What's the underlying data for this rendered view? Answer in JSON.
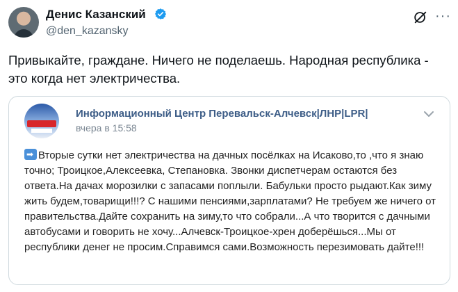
{
  "tweet": {
    "author_name": "Денис Казанский",
    "handle": "@den_kazansky",
    "text": "Привыкайте, граждане. Ничего не поделаешь. Народная республика - это когда нет электричества."
  },
  "card": {
    "source_name": "Информационный Центр Перевальск-Алчевск|ЛНР|LPR|",
    "time": "вчера в 15:58",
    "body": "Вторые сутки нет электричества на дачных посёлках на Исаково,то ,что я знаю точно; Троицкое,Алексеевка, Степановка. Звонки диспетчерам остаются без ответа.На дачах морозилки с запасами поплыли. Бабульки просто рыдают.Как зиму жить будем,товарищи!!!? С нашими пенсиями,зарплатами? Не требуем же ничего от правительства.Дайте сохранить на зиму,то что собрали...А что творится с дачными автобусами и говорить не хочу...Алчевск-Троицкое-хрен доберёшься...Мы от республики денег не просим.Справимся сами.Возможность перезимовать дайте!!!"
  },
  "icons": {
    "verified": "verified-badge-icon",
    "grok": "grok-icon",
    "more": "more-icon",
    "chevron": "chevron-down-icon",
    "arrow": "arrow-right-icon"
  },
  "colors": {
    "verified": "#1d9bf0",
    "source_link": "#3d5d87",
    "secondary_text": "#536471"
  }
}
